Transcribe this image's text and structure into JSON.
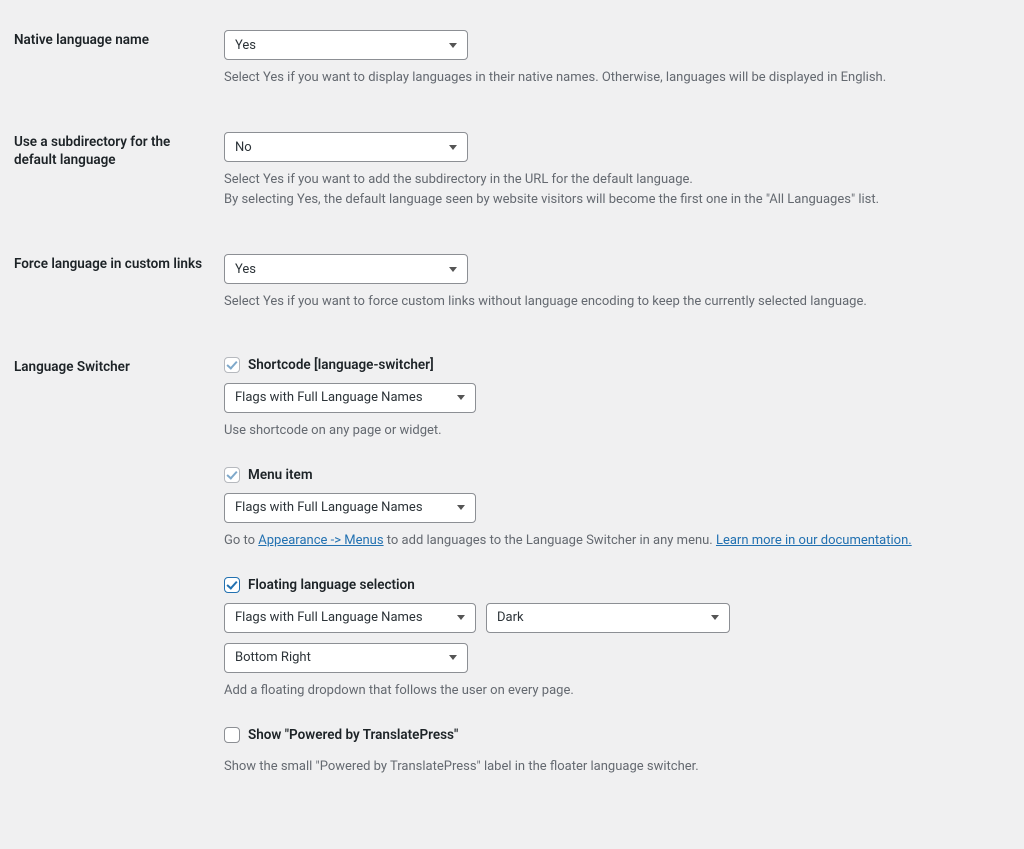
{
  "rows": {
    "native": {
      "label": "Native language name",
      "value": "Yes",
      "desc": "Select Yes if you want to display languages in their native names. Otherwise, languages will be displayed in English."
    },
    "subdir": {
      "label": "Use a subdirectory for the default language",
      "value": "No",
      "desc1": "Select Yes if you want to add the subdirectory in the URL for the default language.",
      "desc2": "By selecting Yes, the default language seen by website visitors will become the first one in the \"All Languages\" list."
    },
    "force": {
      "label": "Force language in custom links",
      "value": "Yes",
      "desc": "Select Yes if you want to force custom links without language encoding to keep the currently selected language."
    },
    "switcher": {
      "label": "Language Switcher",
      "shortcode": {
        "chk_label": "Shortcode [language-switcher]",
        "select": "Flags with Full Language Names",
        "desc": "Use shortcode on any page or widget."
      },
      "menu": {
        "chk_label": "Menu item",
        "select": "Flags with Full Language Names",
        "desc_prefix": "Go to ",
        "link1": "Appearance -> Menus",
        "desc_mid": " to add languages to the Language Switcher in any menu. ",
        "link2": "Learn more in our documentation."
      },
      "floating": {
        "chk_label": "Floating language selection",
        "select_style": "Flags with Full Language Names",
        "select_theme": "Dark",
        "select_position": "Bottom Right",
        "desc": "Add a floating dropdown that follows the user on every page."
      },
      "powered": {
        "chk_label": "Show \"Powered by TranslatePress\"",
        "desc": "Show the small \"Powered by TranslatePress\" label in the floater language switcher."
      }
    }
  }
}
